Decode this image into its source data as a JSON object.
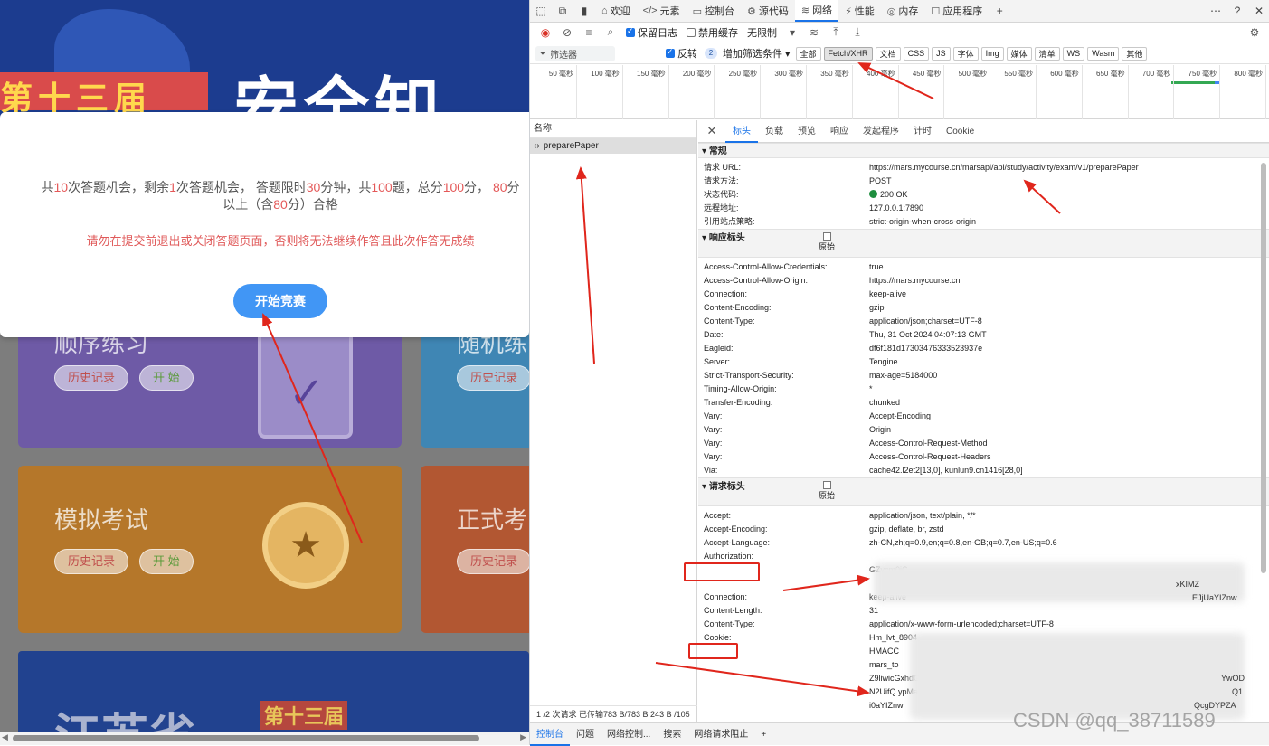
{
  "banner": {
    "title": "第十三届",
    "big": "安全知"
  },
  "modal": {
    "info_prefix": "共",
    "total_chances": "10",
    "info_mid1": "次答题机会，剩余",
    "remaining": "1",
    "info_mid2": "次答题机会，  答题限时",
    "minutes": "30",
    "info_mid3": "分钟，共",
    "questions": "100",
    "info_mid4": "题，总分",
    "score": "100",
    "info_mid5": "分，  ",
    "pass": "80",
    "info_mid6": "分",
    "info_line2a": "以上（含",
    "info_line2b": "分）合格",
    "warning": "请勿在提交前退出或关闭答题页面，否则将无法继续作答且此次作答无成绩",
    "start_button": "开始竞赛"
  },
  "cards": {
    "practice": {
      "title": "顺序练习",
      "history": "历史记录",
      "start": "开 始"
    },
    "quick": {
      "title": "随机练习",
      "history": "历史记录"
    },
    "mock": {
      "title": "模拟考试",
      "history": "历史记录",
      "start": "开 始"
    },
    "formal": {
      "title": "正式考",
      "history": "历史记录"
    }
  },
  "banner2": {
    "t1": "江苏省",
    "t2": "第十三届"
  },
  "devtools": {
    "tabs": [
      {
        "icon": "⌂",
        "label": "欢迎"
      },
      {
        "icon": "</>",
        "label": "元素"
      },
      {
        "icon": "▭",
        "label": "控制台"
      },
      {
        "icon": "⚙",
        "label": "源代码"
      },
      {
        "icon": "≋",
        "label": "网络"
      },
      {
        "icon": "⚡",
        "label": "性能"
      },
      {
        "icon": "◎",
        "label": "内存"
      },
      {
        "icon": "☐",
        "label": "应用程序"
      }
    ],
    "toolbar": {
      "preserve_log": "保留日志",
      "disable_cache": "禁用缓存",
      "throttle": "无限制"
    },
    "filter": {
      "placeholder": "筛选器",
      "invert": "反转",
      "more_filters": "增加筛选条件",
      "count": "2"
    },
    "types": [
      "全部",
      "Fetch/XHR",
      "文档",
      "CSS",
      "JS",
      "字体",
      "Img",
      "媒体",
      "清单",
      "WS",
      "Wasm",
      "其他"
    ],
    "ticks": [
      "50 毫秒",
      "100 毫秒",
      "150 毫秒",
      "200 毫秒",
      "250 毫秒",
      "300 毫秒",
      "350 毫秒",
      "400 毫秒",
      "450 毫秒",
      "500 毫秒",
      "550 毫秒",
      "600 毫秒",
      "650 毫秒",
      "700 毫秒",
      "750 毫秒",
      "800 毫秒"
    ],
    "list": {
      "header": "名称",
      "request": "preparePaper",
      "footer": "1 /2 次请求  已传输783 B/783 B  243 B /105"
    },
    "detail_tabs": [
      "标头",
      "负载",
      "预览",
      "响应",
      "发起程序",
      "计时",
      "Cookie"
    ],
    "general": {
      "title": "常规",
      "rows": [
        {
          "k": "请求 URL:",
          "v": "https://mars.mycourse.cn/marsapi/api/study/activity/exam/v1/preparePaper"
        },
        {
          "k": "请求方法:",
          "v": "POST"
        },
        {
          "k": "状态代码:",
          "v": "200 OK"
        },
        {
          "k": "远程地址:",
          "v": "127.0.0.1:7890"
        },
        {
          "k": "引用站点策略:",
          "v": "strict-origin-when-cross-origin"
        }
      ]
    },
    "response_headers": {
      "title": "响应标头",
      "raw": "原始",
      "rows": [
        {
          "k": "Access-Control-Allow-Credentials:",
          "v": "true"
        },
        {
          "k": "Access-Control-Allow-Origin:",
          "v": "https://mars.mycourse.cn"
        },
        {
          "k": "Connection:",
          "v": "keep-alive"
        },
        {
          "k": "Content-Encoding:",
          "v": "gzip"
        },
        {
          "k": "Content-Type:",
          "v": "application/json;charset=UTF-8"
        },
        {
          "k": "Date:",
          "v": "Thu, 31 Oct 2024 04:07:13 GMT"
        },
        {
          "k": "Eagleid:",
          "v": "df6f181d17303476333523937e"
        },
        {
          "k": "Server:",
          "v": "Tengine"
        },
        {
          "k": "Strict-Transport-Security:",
          "v": "max-age=5184000"
        },
        {
          "k": "Timing-Allow-Origin:",
          "v": "*"
        },
        {
          "k": "Transfer-Encoding:",
          "v": "chunked"
        },
        {
          "k": "Vary:",
          "v": "Accept-Encoding"
        },
        {
          "k": "Vary:",
          "v": "Origin"
        },
        {
          "k": "Vary:",
          "v": "Access-Control-Request-Method"
        },
        {
          "k": "Vary:",
          "v": "Access-Control-Request-Headers"
        },
        {
          "k": "Via:",
          "v": "cache42.l2et2[13,0], kunlun9.cn1416[28,0]"
        }
      ]
    },
    "request_headers": {
      "title": "请求标头",
      "raw": "原始",
      "rows": [
        {
          "k": "Accept:",
          "v": "application/json, text/plain, */*"
        },
        {
          "k": "Accept-Encoding:",
          "v": "gzip, deflate, br, zstd"
        },
        {
          "k": "Accept-Language:",
          "v": "zh-CN,zh;q=0.9,en;q=0.8,en-GB;q=0.7,en-US;q=0.6"
        },
        {
          "k": "Authorization:",
          "v": ""
        },
        {
          "k": "",
          "v": "GZvcm0iC"
        },
        {
          "k": "",
          "v": ""
        },
        {
          "k": "Connection:",
          "v": "keep-alive"
        },
        {
          "k": "Content-Length:",
          "v": "31"
        },
        {
          "k": "Content-Type:",
          "v": "application/x-www-form-urlencoded;charset=UTF-8"
        },
        {
          "k": "Cookie:",
          "v": "Hm_lvt_8904"
        },
        {
          "k": "",
          "v": "HMACC"
        },
        {
          "k": "",
          "v": "mars_to"
        },
        {
          "k": "",
          "v": "Z9liwicGxhdGZvcm0iOi"
        },
        {
          "k": "",
          "v": "N2UifQ.ypMa"
        },
        {
          "k": "",
          "v": "i0aYIZnw"
        }
      ],
      "right_fragments": [
        "xKIMZ",
        "EJjUaYIZnw",
        "YwOD",
        "Q1",
        "QcgDYPZA"
      ]
    },
    "bottom_tabs": [
      "控制台",
      "问题",
      "网络控制...",
      "搜索",
      "网络请求阻止"
    ]
  },
  "watermark": "CSDN @qq_38711589"
}
